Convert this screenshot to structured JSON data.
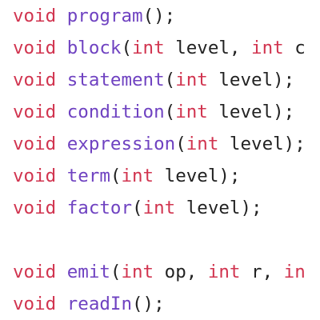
{
  "theme": {
    "keyword_color": "#d1344f",
    "function_color": "#6f42c1",
    "text_color": "#222222",
    "background": "#ffffff"
  },
  "lines": [
    {
      "tokens": [
        {
          "t": "void",
          "c": "kw"
        },
        {
          "t": " ",
          "c": "plain"
        },
        {
          "t": "program",
          "c": "fn"
        },
        {
          "t": "();",
          "c": "plain"
        }
      ]
    },
    {
      "tokens": [
        {
          "t": "void",
          "c": "kw"
        },
        {
          "t": " ",
          "c": "plain"
        },
        {
          "t": "block",
          "c": "fn"
        },
        {
          "t": "(",
          "c": "plain"
        },
        {
          "t": "int",
          "c": "kw"
        },
        {
          "t": " level, ",
          "c": "plain"
        },
        {
          "t": "int",
          "c": "kw"
        },
        {
          "t": " c",
          "c": "plain"
        }
      ]
    },
    {
      "tokens": [
        {
          "t": "void",
          "c": "kw"
        },
        {
          "t": " ",
          "c": "plain"
        },
        {
          "t": "statement",
          "c": "fn"
        },
        {
          "t": "(",
          "c": "plain"
        },
        {
          "t": "int",
          "c": "kw"
        },
        {
          "t": " level);",
          "c": "plain"
        }
      ]
    },
    {
      "tokens": [
        {
          "t": "void",
          "c": "kw"
        },
        {
          "t": " ",
          "c": "plain"
        },
        {
          "t": "condition",
          "c": "fn"
        },
        {
          "t": "(",
          "c": "plain"
        },
        {
          "t": "int",
          "c": "kw"
        },
        {
          "t": " level);",
          "c": "plain"
        }
      ]
    },
    {
      "tokens": [
        {
          "t": "void",
          "c": "kw"
        },
        {
          "t": " ",
          "c": "plain"
        },
        {
          "t": "expression",
          "c": "fn"
        },
        {
          "t": "(",
          "c": "plain"
        },
        {
          "t": "int",
          "c": "kw"
        },
        {
          "t": " level);",
          "c": "plain"
        }
      ]
    },
    {
      "tokens": [
        {
          "t": "void",
          "c": "kw"
        },
        {
          "t": " ",
          "c": "plain"
        },
        {
          "t": "term",
          "c": "fn"
        },
        {
          "t": "(",
          "c": "plain"
        },
        {
          "t": "int",
          "c": "kw"
        },
        {
          "t": " level);",
          "c": "plain"
        }
      ]
    },
    {
      "tokens": [
        {
          "t": "void",
          "c": "kw"
        },
        {
          "t": " ",
          "c": "plain"
        },
        {
          "t": "factor",
          "c": "fn"
        },
        {
          "t": "(",
          "c": "plain"
        },
        {
          "t": "int",
          "c": "kw"
        },
        {
          "t": " level);",
          "c": "plain"
        }
      ]
    },
    {
      "tokens": []
    },
    {
      "tokens": [
        {
          "t": "void",
          "c": "kw"
        },
        {
          "t": " ",
          "c": "plain"
        },
        {
          "t": "emit",
          "c": "fn"
        },
        {
          "t": "(",
          "c": "plain"
        },
        {
          "t": "int",
          "c": "kw"
        },
        {
          "t": " op, ",
          "c": "plain"
        },
        {
          "t": "int",
          "c": "kw"
        },
        {
          "t": " r, ",
          "c": "plain"
        },
        {
          "t": "in",
          "c": "kw"
        }
      ]
    },
    {
      "tokens": [
        {
          "t": "void",
          "c": "kw"
        },
        {
          "t": " ",
          "c": "plain"
        },
        {
          "t": "readIn",
          "c": "fn"
        },
        {
          "t": "();",
          "c": "plain"
        }
      ]
    }
  ]
}
